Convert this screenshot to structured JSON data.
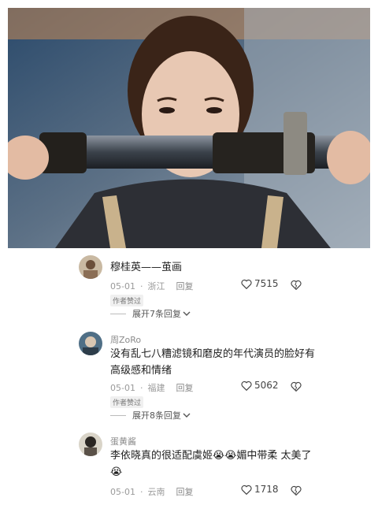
{
  "photo": {
    "alt_icon": "drama-still-image"
  },
  "comments": [
    {
      "username": "",
      "text": "穆桂英——茧画",
      "date": "05-01",
      "location": "浙江",
      "reply_label": "回复",
      "likes": "7515",
      "author_badge": "作者赞过",
      "expand_label": "展开7条回复"
    },
    {
      "username": "周ZoRo",
      "text": "没有乱七八糟滤镜和磨皮的年代演员的脸好有高级感和情绪",
      "date": "05-01",
      "location": "福建",
      "reply_label": "回复",
      "likes": "5062",
      "author_badge": "作者赞过",
      "expand_label": "展开8条回复"
    },
    {
      "username": "蛋黄酱",
      "text": "李依晓真的很适配虞姬😭😭媚中带柔 太美了😭",
      "date": "05-01",
      "location": "云南",
      "reply_label": "回复",
      "likes": "1718"
    }
  ]
}
